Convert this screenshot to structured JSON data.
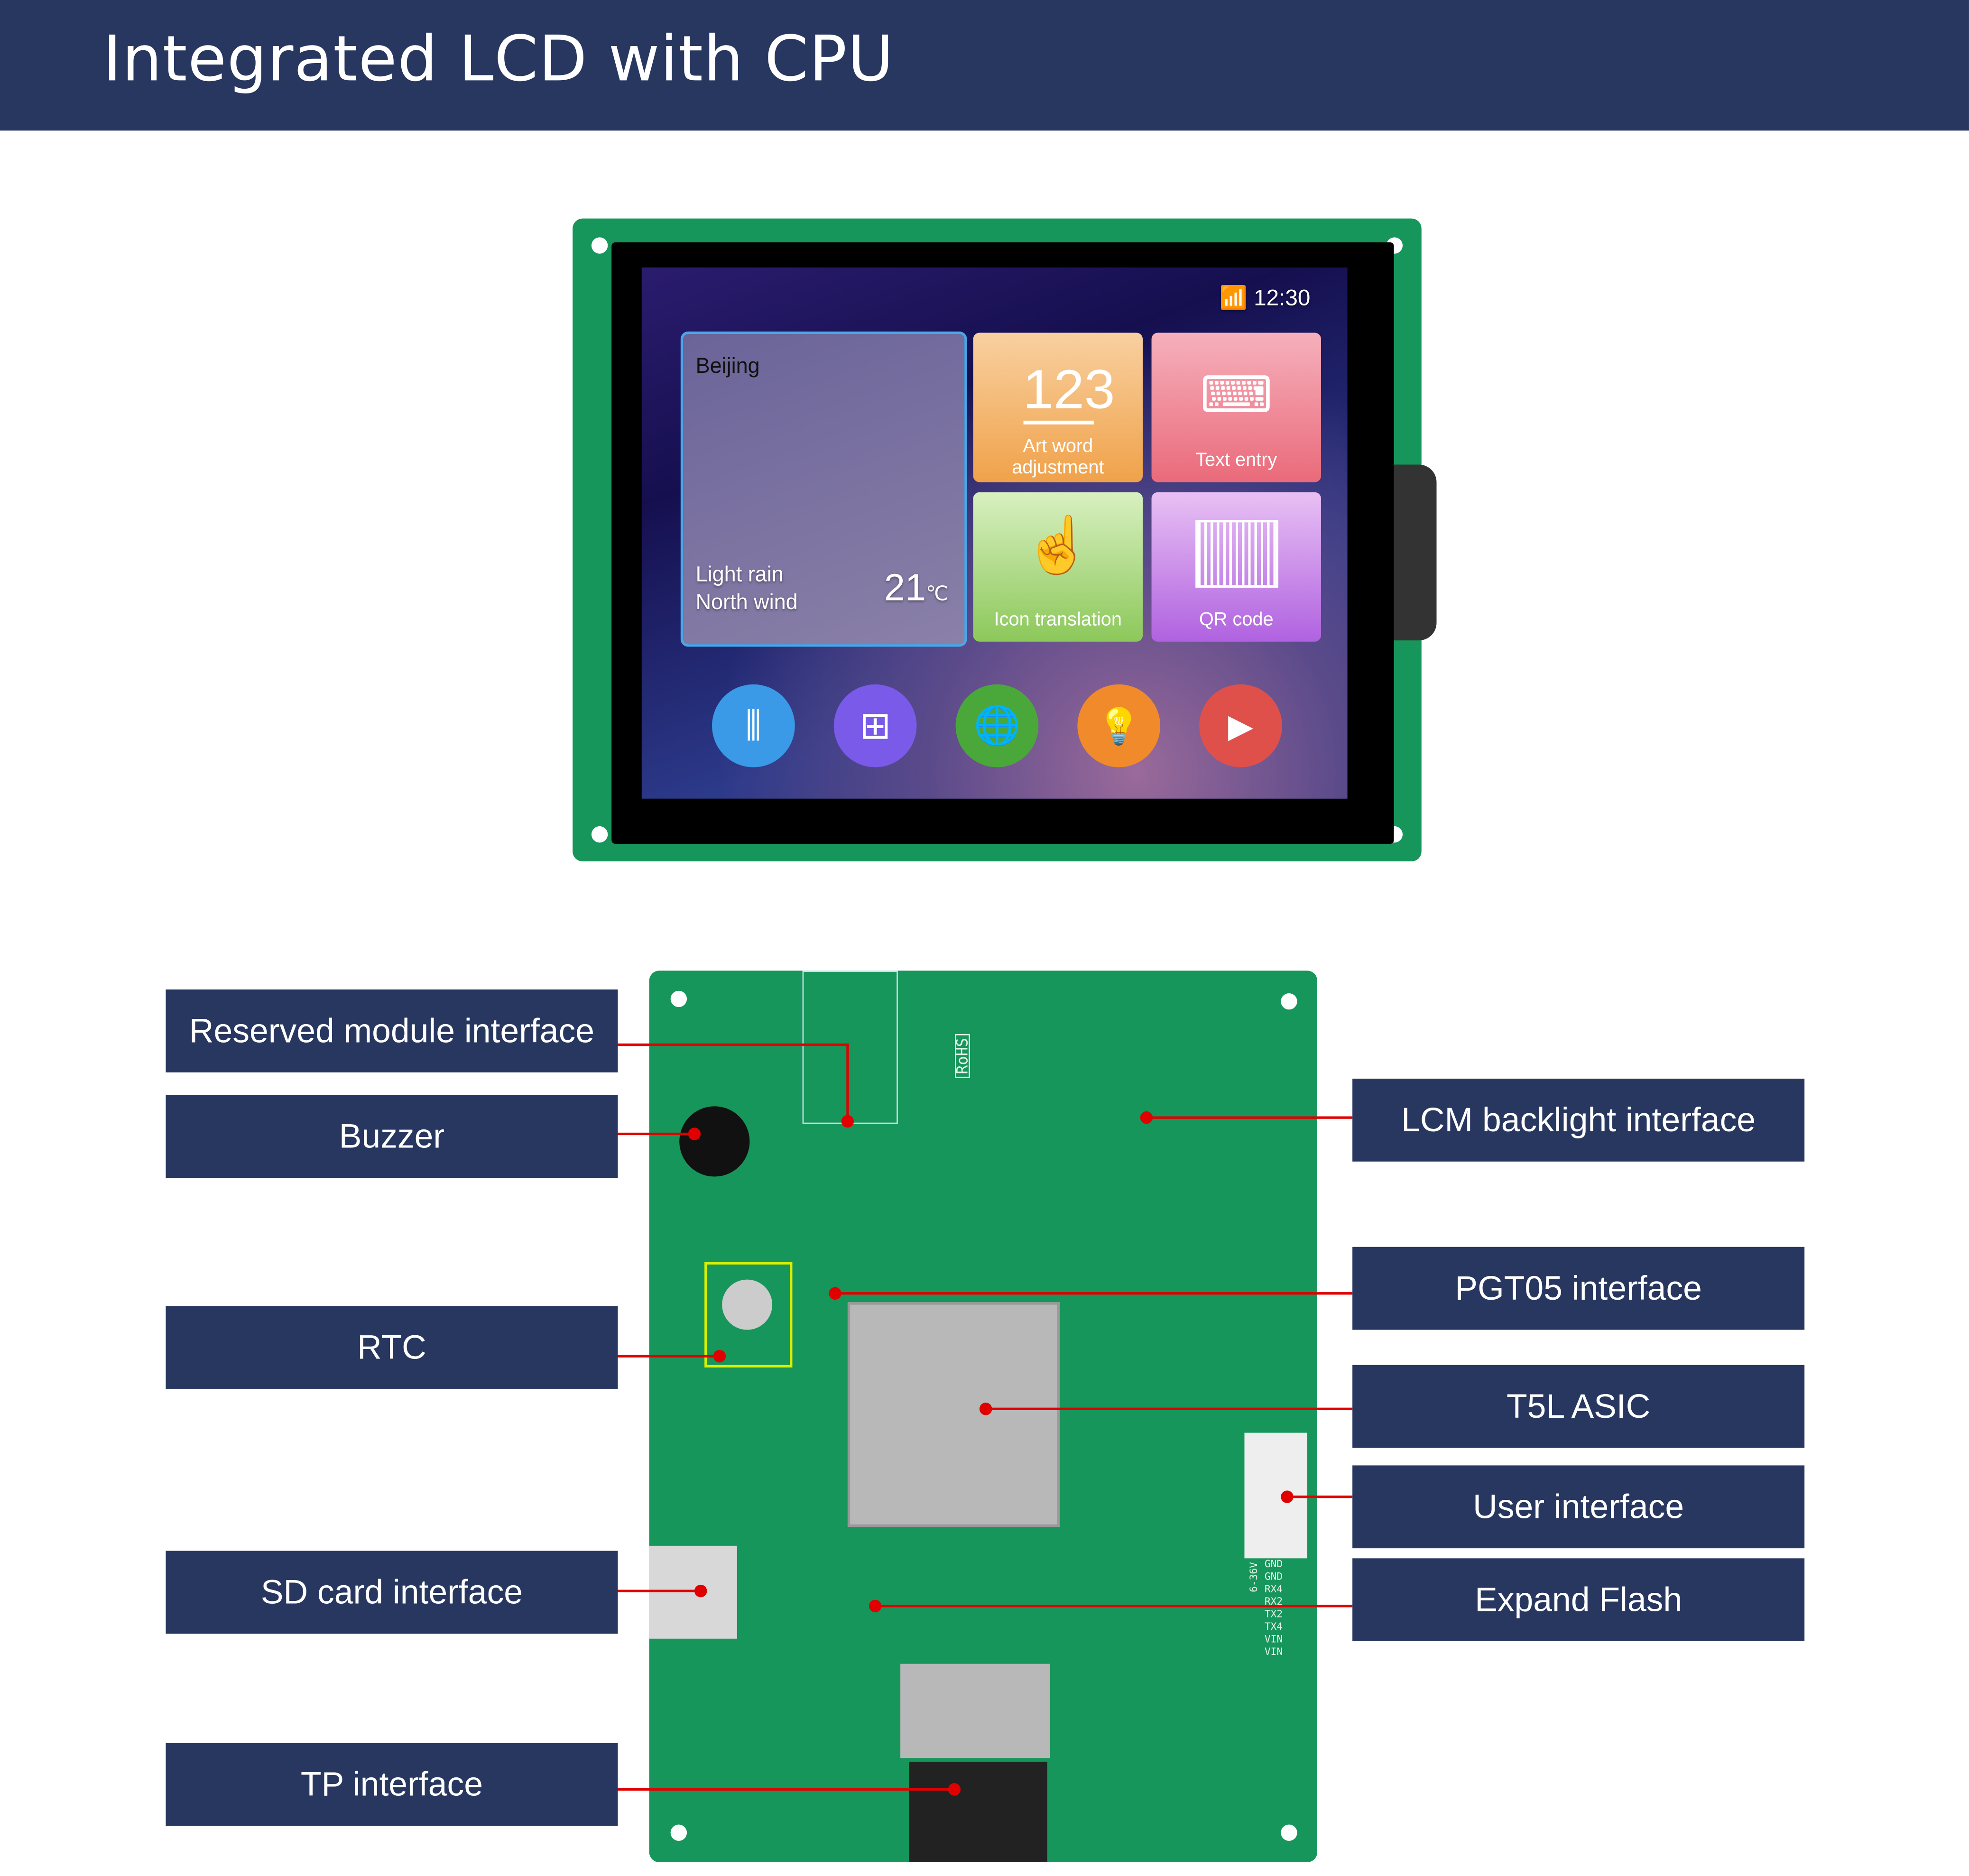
{
  "header": {
    "title": "Integrated LCD with CPU"
  },
  "lcd_screen": {
    "status": {
      "icon": "wifi-icon",
      "time": "12:30"
    },
    "weather": {
      "city": "Beijing",
      "condition": "Light rain",
      "wind": "North wind",
      "temperature": "21",
      "unit": "℃"
    },
    "tiles": [
      {
        "label": "Art word adjustment",
        "glyph": "123",
        "icon": "number-icon",
        "color": "#f0a24a"
      },
      {
        "label": "Text entry",
        "icon": "keyboard-icon",
        "color": "#ea6a7a"
      },
      {
        "label": "Icon translation",
        "icon": "hand-swipe-icon",
        "color": "#8cc85a"
      },
      {
        "label": "QR code",
        "icon": "barcode-icon",
        "color": "#b062e0"
      }
    ],
    "dock": [
      {
        "icon": "sliders-icon",
        "color": "#3a9ae8"
      },
      {
        "icon": "grid-icon",
        "color": "#7a5ae8"
      },
      {
        "icon": "globe-icon",
        "color": "#4aa83a"
      },
      {
        "icon": "bulb-icon",
        "color": "#f08a2a"
      },
      {
        "icon": "play-icon",
        "color": "#e0504a"
      }
    ]
  },
  "pcb_silk": {
    "rohs": "RoHS",
    "pins": [
      "GND",
      "GND",
      "RX4",
      "RX2",
      "TX2",
      "TX4",
      "VIN",
      "VIN"
    ],
    "voltage": "6-36V"
  },
  "callouts": {
    "left": [
      "Reserved module interface",
      "Buzzer",
      "RTC",
      "SD card interface",
      "TP interface"
    ],
    "right": [
      "LCM backlight interface",
      "PGT05 interface",
      "T5L ASIC",
      "User interface",
      "Expand Flash"
    ]
  },
  "colors": {
    "label_bg": "#283760",
    "leader": "#e00000",
    "pcb": "#16965a"
  }
}
